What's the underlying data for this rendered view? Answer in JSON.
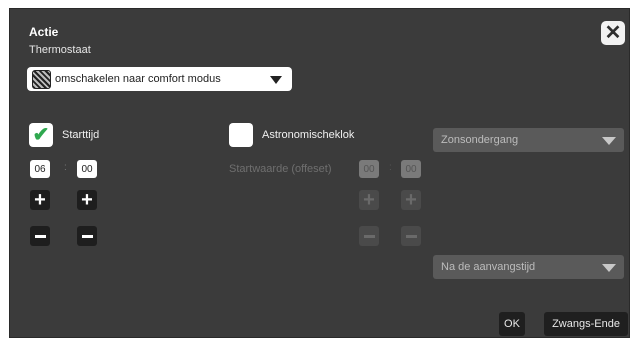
{
  "dialog": {
    "title": "Actie",
    "section_label": "Thermostaat",
    "action_select": {
      "value": "omschakelen naar comfort modus",
      "icon": "comfort-mode-icon"
    }
  },
  "start_time": {
    "checkbox_label": "Starttijd",
    "checked": true,
    "hour": "06",
    "separator": ":",
    "minute": "00"
  },
  "astro": {
    "checkbox_label": "Astronomischeklok",
    "checked": false,
    "offset_label": "Startwaarde (offeset)",
    "hour": "00",
    "separator": ":",
    "minute": "00"
  },
  "selects": {
    "sun_event": "Zonsondergang",
    "timing": "Na de aanvangstijd"
  },
  "footer": {
    "ok_label": "OK",
    "force_end_label": "Zwangs-Ende"
  },
  "icons": {
    "close": "close-icon",
    "check": "checkmark-icon",
    "plus": "plus-icon",
    "minus": "minus-icon",
    "dropdown": "chevron-down-icon"
  },
  "colors": {
    "dialog_bg": "#3b3b3b",
    "check_green": "#2fa84f"
  }
}
